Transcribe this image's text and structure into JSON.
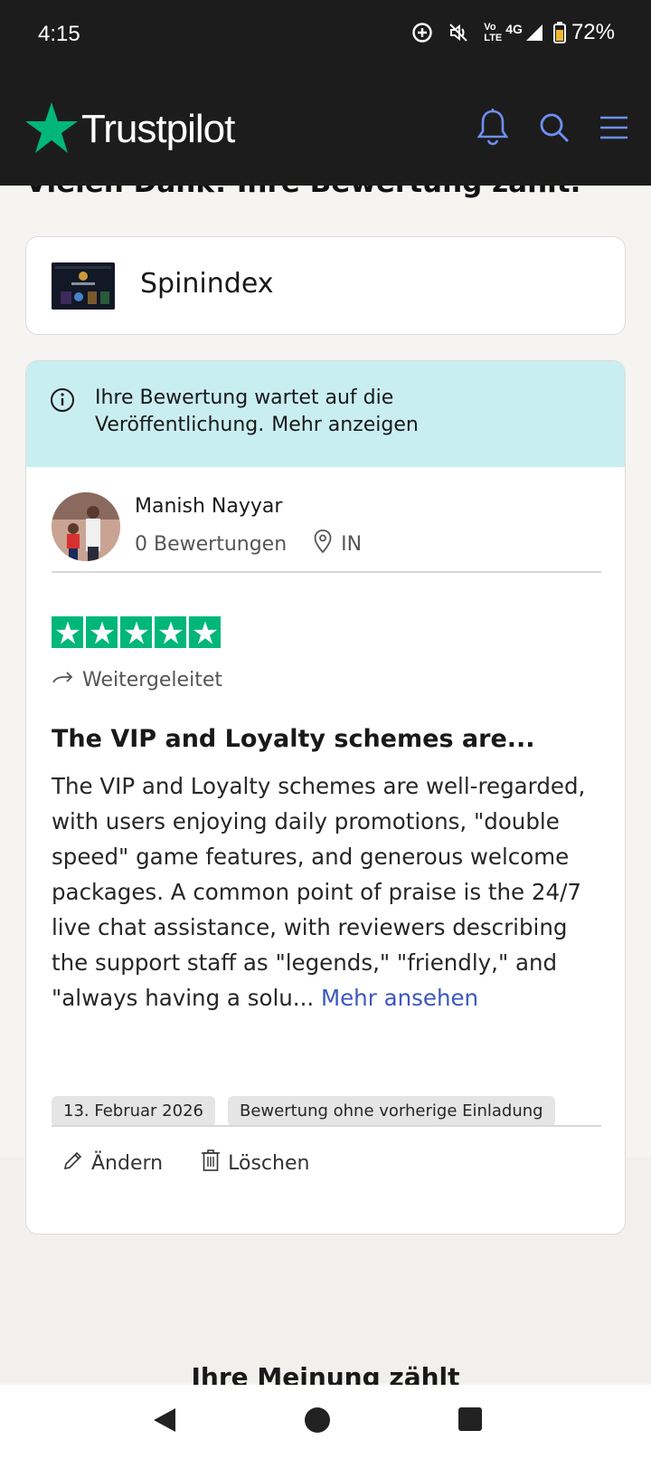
{
  "status_bar": {
    "time": "4:15",
    "network_top": "Vo",
    "network_bottom": "LTE",
    "network_type": "4G",
    "battery": "72%"
  },
  "header": {
    "logo_text": "Trustpilot",
    "icons": [
      "bell-icon",
      "search-icon",
      "menu-icon"
    ],
    "brand_color": "#00b67a",
    "icon_color": "#6f8ff2"
  },
  "page": {
    "heading": "Vielen Dank! Ihre Bewertung zählt."
  },
  "company": {
    "name": "Spinindex"
  },
  "notice": {
    "text": "Ihre Bewertung wartet auf die Veröffentlichung.",
    "more_label": "Mehr anzeigen"
  },
  "reviewer": {
    "name": "Manish Nayyar",
    "review_count": "0 Bewertungen",
    "country": "IN"
  },
  "review": {
    "rating": 5,
    "rating_max": 5,
    "forwarded_label": "Weitergeleitet",
    "title": "The VIP and Loyalty schemes are...",
    "body": "The VIP and Loyalty schemes are well-regarded, with users enjoying daily promotions, \"double speed\" game features, and generous welcome packages. A common point of praise is the 24/7 live chat assistance, with reviewers describing the support staff as \"legends,\" \"friendly,\" and \"always having a solu...",
    "more_label": "Mehr ansehen",
    "date": "13. Februar 2026",
    "invite_tag": "Bewertung ohne vorherige Einladung"
  },
  "actions": {
    "edit_label": "Ändern",
    "delete_label": "Löschen"
  },
  "footer": {
    "heading": "Ihre Meinung zählt"
  },
  "navigation": [
    "back-icon",
    "home-icon",
    "recents-icon"
  ]
}
